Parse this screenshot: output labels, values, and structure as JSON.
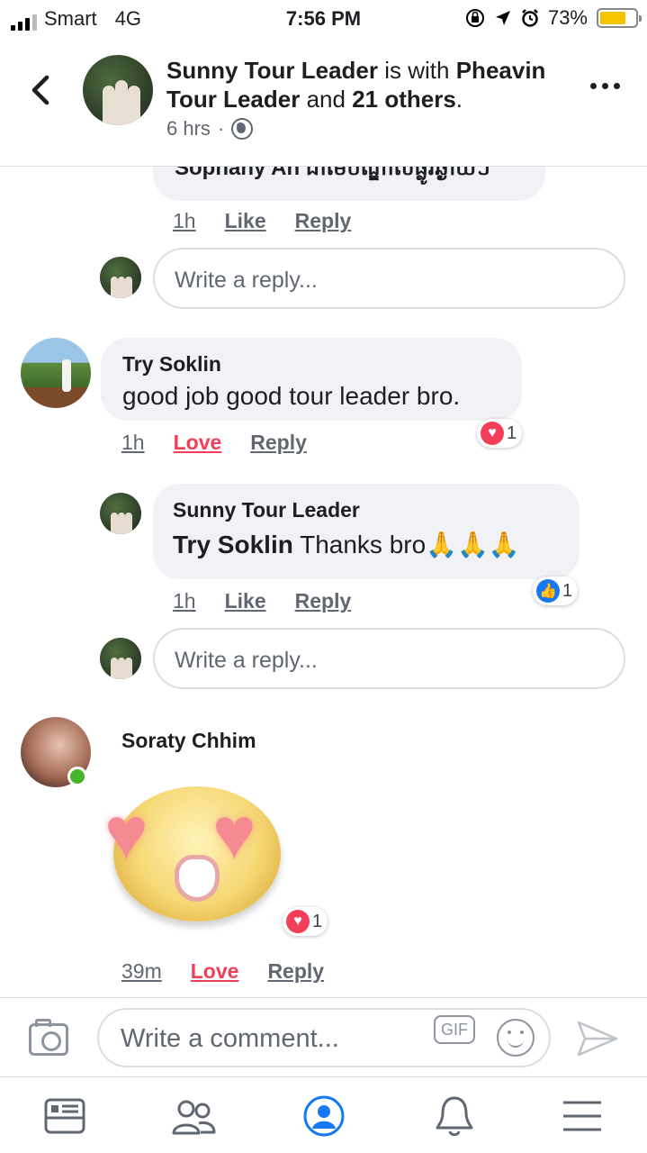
{
  "status_bar": {
    "carrier": "Smart",
    "network": "4G",
    "time": "7:56 PM",
    "battery_percent": "73%",
    "battery_level": 0.73
  },
  "post_header": {
    "author": "Sunny Tour Leader",
    "with_text": "is with",
    "tagged": "Pheavin Tour Leader",
    "and_text": "and",
    "others": "21 others",
    "time": "6 hrs",
    "separator": "·"
  },
  "comments": {
    "partial_reply": {
      "text": "Sophany An ជាមេបណ្ឌាលផ្លូវឆ្ងាយៗ",
      "time": "1h",
      "like": "Like",
      "reply": "Reply"
    },
    "reply_input_1": {
      "placeholder": "Write a reply..."
    },
    "try_soklin": {
      "author": "Try Soklin",
      "text": "good job good tour leader bro.",
      "time": "1h",
      "reaction_label": "Love",
      "reply": "Reply",
      "reaction_count": "1"
    },
    "sunny_reply": {
      "author": "Sunny Tour Leader",
      "mention": "Try Soklin",
      "text": "Thanks bro",
      "emoji": "🙏🙏🙏",
      "time": "1h",
      "like": "Like",
      "reply": "Reply",
      "reaction_count": "1"
    },
    "reply_input_2": {
      "placeholder": "Write a reply..."
    },
    "soraty": {
      "author": "Soraty Chhim",
      "time": "39m",
      "reaction_label": "Love",
      "reply": "Reply",
      "reaction_count": "1"
    }
  },
  "composer": {
    "placeholder": "Write a comment...",
    "gif": "GIF"
  },
  "icons": {
    "back": "chevron-left-icon",
    "more": "more-icon",
    "privacy": "globe-icon",
    "camera": "camera-icon",
    "emoji": "smile-icon",
    "send": "send-icon",
    "tabs": [
      "news-feed-icon",
      "friends-icon",
      "profile-icon",
      "notifications-icon",
      "menu-icon"
    ]
  },
  "colors": {
    "love": "#f33e58",
    "like": "#1877f2",
    "bubble": "#f0f2f5",
    "online": "#42b72a",
    "active_tab": "#1877f2"
  }
}
